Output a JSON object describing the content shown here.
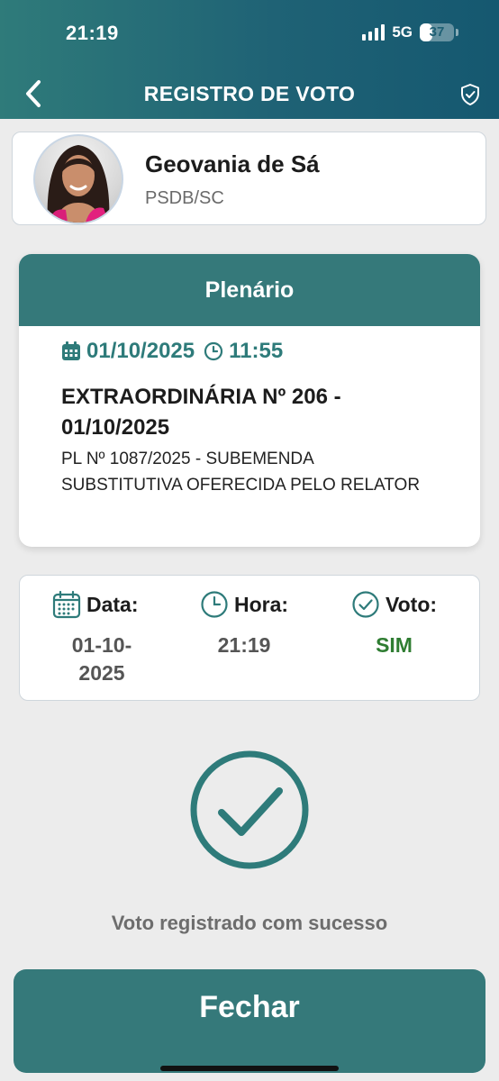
{
  "status_bar": {
    "time": "21:19",
    "network": "5G",
    "battery": "37",
    "battery_level": 0.37
  },
  "header": {
    "title": "REGISTRO DE VOTO",
    "back_icon": "chevron-left-icon",
    "shield_icon": "shield-check-icon"
  },
  "profile": {
    "name": "Geovania de Sá",
    "party": "PSDB/SC"
  },
  "session": {
    "heading": "Plenário",
    "date": "01/10/2025",
    "time": "11:55",
    "name": "EXTRAORDINÁRIA Nº 206 - 01/10/2025",
    "description": "PL Nº 1087/2025 - SUBEMENDA SUBSTITUTIVA OFERECIDA PELO RELATOR"
  },
  "summary": {
    "date_label": "Data:",
    "date_value": "01-10-2025",
    "time_label": "Hora:",
    "time_value": "21:19",
    "vote_label": "Voto:",
    "vote_value": "SIM"
  },
  "success": {
    "message": "Voto registrado com sucesso"
  },
  "close_button": {
    "label": "Fechar"
  },
  "colors": {
    "accent": "#35797a",
    "header_start": "#2f7b7a",
    "header_end": "#155870",
    "vote_yes": "#2f7d32"
  }
}
